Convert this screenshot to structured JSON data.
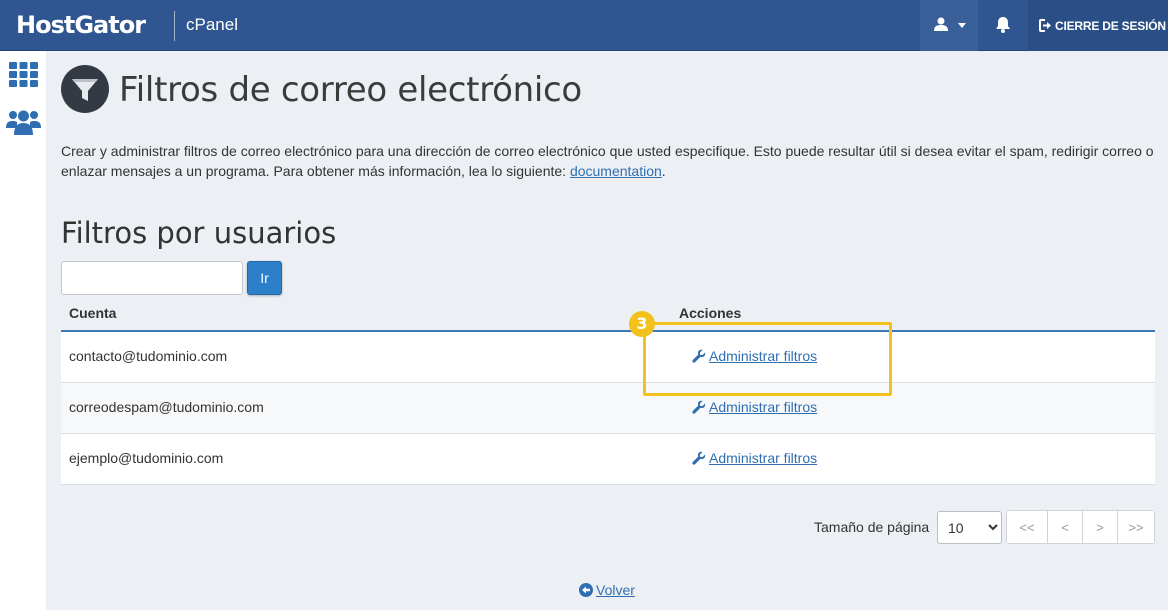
{
  "header": {
    "brand": "HostGator",
    "product": "cPanel",
    "logout_label": "CIERRE DE SESIÓN",
    "icons": [
      "user-icon",
      "chevron-down-icon",
      "bell-icon",
      "logout-icon"
    ]
  },
  "sidebar": {
    "icons": [
      "grid-icon",
      "users-icon"
    ]
  },
  "page": {
    "title": "Filtros de correo electrónico",
    "icon": "funnel-icon",
    "description": "Crear y administrar filtros de correo electrónico para una dirección de correo electrónico que usted especifique. Esto puede resultar útil si desea evitar el spam, redirigir correo o enlazar mensajes a un programa. Para obtener más información, lea lo siguiente: ",
    "doc_link": "documentation",
    "description_end": "."
  },
  "user_filters": {
    "title": "Filtros por usuarios",
    "search_value": "",
    "go_label": "Ir",
    "columns": {
      "account": "Cuenta",
      "actions": "Acciones"
    },
    "rows": [
      {
        "account": "contacto@tudominio.com",
        "action": "Administrar filtros"
      },
      {
        "account": "correodespam@tudominio.com",
        "action": "Administrar filtros"
      },
      {
        "account": "ejemplo@tudominio.com",
        "action": "Administrar filtros"
      }
    ]
  },
  "annotation": {
    "step": "3",
    "color": "#f3c01c"
  },
  "pagination": {
    "page_size_label": "Tamaño de página",
    "page_size": "10",
    "first": "<<",
    "prev": "<",
    "next": ">",
    "last": ">>"
  },
  "back_label": "Volver",
  "colors": {
    "header": "#2f5690",
    "link": "#2f6fb1",
    "button": "#2d7fc9",
    "highlight": "#f3c01c"
  }
}
